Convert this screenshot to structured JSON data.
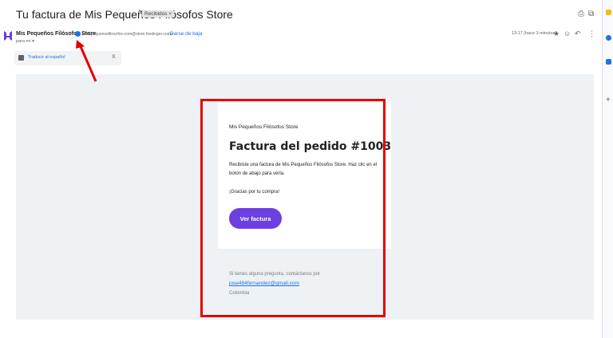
{
  "header": {
    "subject": "Tu factura de Mis Pequeños Filósofos Store",
    "label_chip": "Recibidos ×",
    "print_icon": "print-icon",
    "open_new_icon": "open-in-new-icon"
  },
  "sender": {
    "name": "Mis Pequeños Filósofos Store",
    "email": "<mispequenosfilosofos-com@store.hostinger.com>",
    "unsubscribe": "Darse de baja",
    "to": "para mí ▾",
    "time": "13:17 (hace 3 minutos)",
    "actions": [
      "★",
      "☺",
      "↶",
      "⋮"
    ]
  },
  "translate": {
    "text": "Traducir al español",
    "close": "X"
  },
  "email": {
    "store": "Mis Pequeños Filósofos Store",
    "title": "Factura del pedido #1003",
    "description": "Recibiste una factura de Mis Pequeños Filósofos Store. Haz clic en el botón de abajo para verla.",
    "thanks": "¡Gracias por tu compra!",
    "button": "Ver factura",
    "footer_question": "Si tienes alguna pregunta, contáctanos por",
    "footer_email": "jose484fernandez@gmail.com",
    "footer_country": "Colombia"
  },
  "colors": {
    "accent_purple": "#6c3fe0",
    "annotation_red": "#e60000",
    "link_blue": "#1a73e8"
  }
}
